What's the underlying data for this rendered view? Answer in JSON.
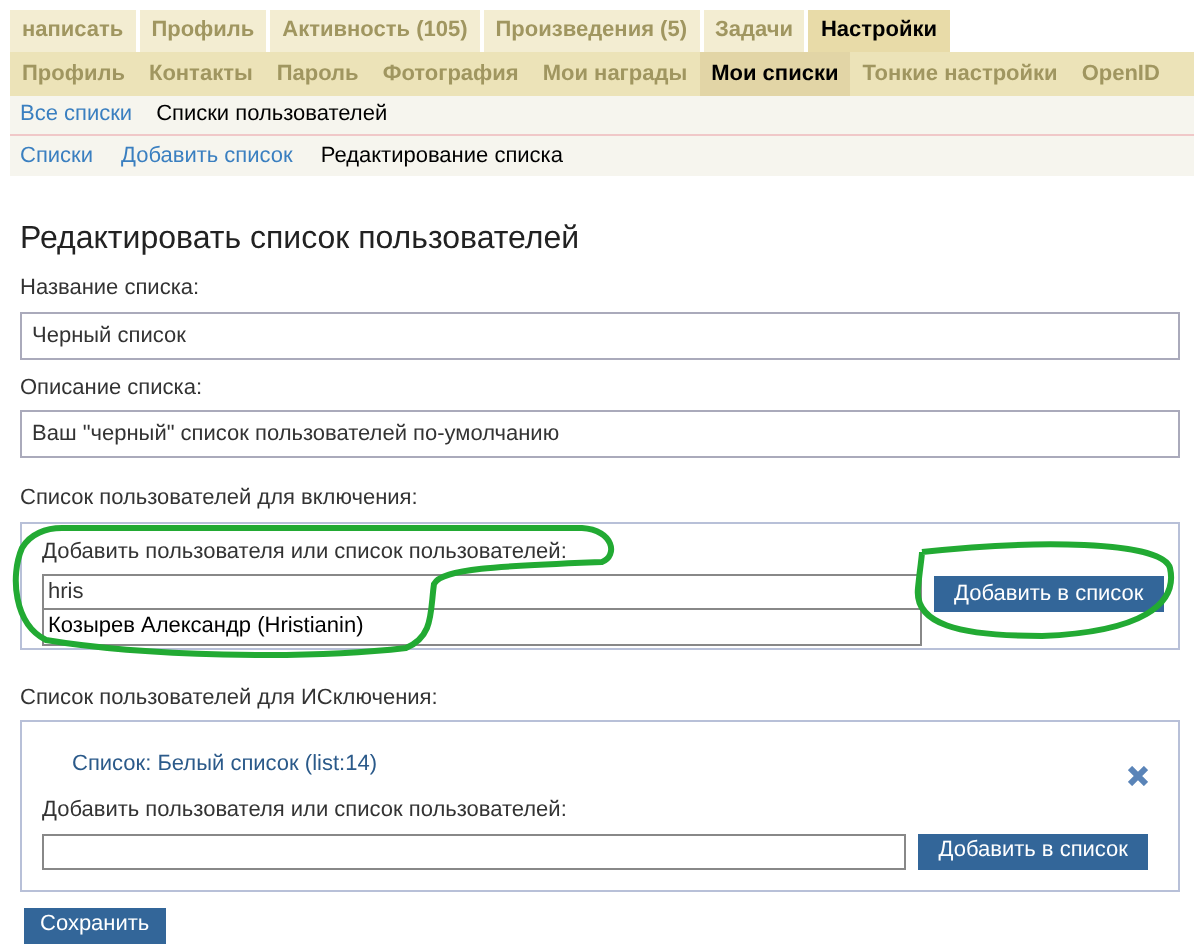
{
  "main_tabs": [
    {
      "label": "написать",
      "selected": false
    },
    {
      "label": "Профиль",
      "selected": false
    },
    {
      "label": "Активность (105)",
      "selected": false
    },
    {
      "label": "Произведения (5)",
      "selected": false
    },
    {
      "label": "Задачи",
      "selected": false
    },
    {
      "label": "Настройки",
      "selected": true
    }
  ],
  "settings_tabs": [
    {
      "label": "Профиль",
      "selected": false
    },
    {
      "label": "Контакты",
      "selected": false
    },
    {
      "label": "Пароль",
      "selected": false
    },
    {
      "label": "Фотография",
      "selected": false
    },
    {
      "label": "Мои награды",
      "selected": false
    },
    {
      "label": "Мои списки",
      "selected": true
    },
    {
      "label": "Тонкие настройки",
      "selected": false
    },
    {
      "label": "OpenID",
      "selected": false
    }
  ],
  "list_tabs": [
    {
      "label": "Все списки",
      "selected": false
    },
    {
      "label": "Списки пользователей",
      "selected": true
    }
  ],
  "breadcrumbs": [
    {
      "label": "Списки",
      "selected": false
    },
    {
      "label": "Добавить список",
      "selected": false
    },
    {
      "label": "Редактирование списка",
      "selected": true
    }
  ],
  "heading": "Редактировать список пользователей",
  "name_field": {
    "label": "Название списка:",
    "value": "Черный список"
  },
  "description_field": {
    "label": "Описание списка:",
    "value": "Ваш \"черный\" список пользователей по-умолчанию"
  },
  "include_section": {
    "label": "Список пользователей для включения:",
    "add_label": "Добавить пользователя или список пользователей:",
    "value": "hris",
    "suggestion": "Козырев Александр (Hristianin)",
    "button": "Добавить в список"
  },
  "exclude_section": {
    "label": "Список пользователей для ИСключения:",
    "entry": "Список: Белый список (list:14)",
    "add_label": "Добавить пользователя или список пользователей:",
    "button": "Добавить в список"
  },
  "save_button": "Сохранить"
}
